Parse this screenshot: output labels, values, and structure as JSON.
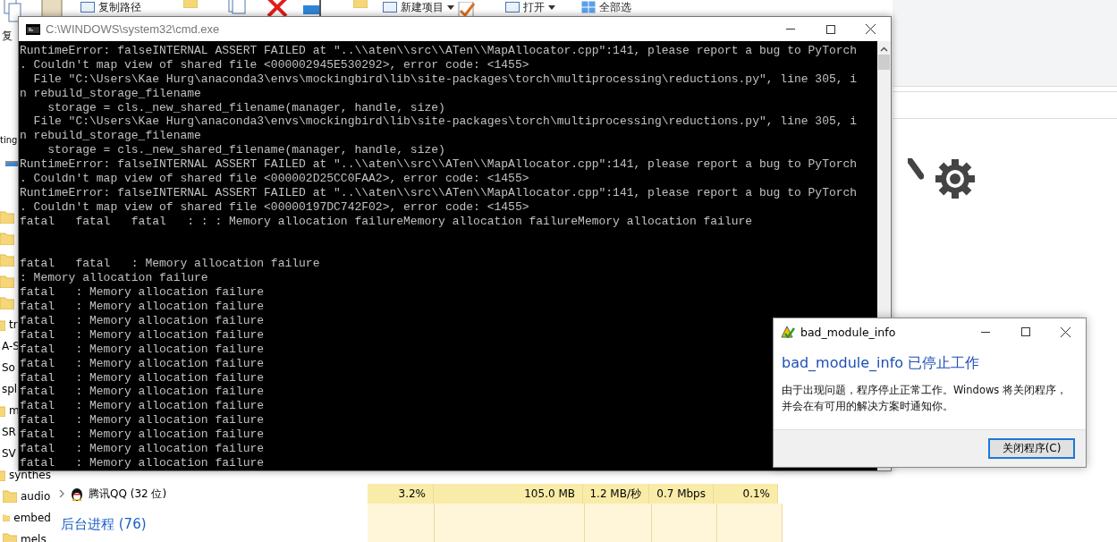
{
  "explorer": {
    "ribbon": [
      {
        "label": "复"
      },
      {
        "label": "复制路径"
      },
      {
        "label": "新建项目",
        "dropdown": true
      },
      {
        "label": "打开",
        "dropdown": true
      },
      {
        "label": "全部选"
      }
    ],
    "sidebar": {
      "header": "ting",
      "items": [
        {
          "kind": "folder"
        },
        {
          "kind": "folder"
        },
        {
          "kind": "folder"
        },
        {
          "kind": "folder"
        },
        {
          "kind": "folder"
        },
        {
          "kind": "folder",
          "text": "tr"
        },
        {
          "kind": "file",
          "text": "A-S"
        },
        {
          "kind": "file",
          "text": "So"
        },
        {
          "kind": "file",
          "text": "spl"
        },
        {
          "kind": "folder",
          "text": "m"
        },
        {
          "kind": "file",
          "text": "SR"
        },
        {
          "kind": "file",
          "text": "SV"
        },
        {
          "kind": "folder",
          "text": "synthes",
          "children": [
            {
              "kind": "folder",
              "text": "audio"
            },
            {
              "kind": "folder",
              "text": "embed"
            },
            {
              "kind": "folder",
              "text": "mels"
            }
          ]
        }
      ]
    }
  },
  "task_manager": {
    "rows": [
      {
        "name": "腾讯QQ (32 位)",
        "expanded": false,
        "cells": [
          "3.2%",
          "105.0 MB",
          "1.2 MB/秒",
          "0.7 Mbps",
          "0.1%"
        ]
      }
    ],
    "group": "后台进程 (76)"
  },
  "console": {
    "title": "C:\\WINDOWS\\system32\\cmd.exe",
    "lines": [
      {
        "text": "RuntimeError: falseINTERNAL ASSERT FAILED at \"..\\\\aten\\\\src\\\\ATen\\\\MapAllocator.cpp\":141, please report a bug to PyTorch"
      },
      {
        "text": ". Couldn't map view of shared file <000002945E530292>, error code: <1455>"
      },
      {
        "text": "  File \"C:\\Users\\Kae Hurg\\anaconda3\\envs\\mockingbird\\lib\\site-packages\\torch\\multiprocessing\\reductions.py\", line 305, i"
      },
      {
        "text": "n rebuild_storage_filename"
      },
      {
        "text": "    storage = cls._new_shared_filename(manager, handle, size)"
      },
      {
        "text": "  File \"C:\\Users\\Kae Hurg\\anaconda3\\envs\\mockingbird\\lib\\site-packages\\torch\\multiprocessing\\reductions.py\", line 305, i"
      },
      {
        "text": "n rebuild_storage_filename"
      },
      {
        "text": "    storage = cls._new_shared_filename(manager, handle, size)"
      },
      {
        "text": "RuntimeError: falseINTERNAL ASSERT FAILED at \"..\\\\aten\\\\src\\\\ATen\\\\MapAllocator.cpp\":141, please report a bug to PyTorch"
      },
      {
        "text": ". Couldn't map view of shared file <000002D25CC0FAA2>, error code: <1455>"
      },
      {
        "text": "RuntimeError: falseINTERNAL ASSERT FAILED at \"..\\\\aten\\\\src\\\\ATen\\\\MapAllocator.cpp\":141, please report a bug to PyTorch"
      },
      {
        "text": ". Couldn't map view of shared file <00000197DC742F02>, error code: <1455>"
      },
      {
        "text": "fatal   fatal   fatal   : : : Memory allocation failureMemory allocation failureMemory allocation failure"
      },
      {
        "text": "fatal   fatal   : Memory allocation failure",
        "blank_lines_before": true
      },
      {
        "text": ": Memory allocation failure"
      },
      {
        "text": "fatal   : Memory allocation failure"
      },
      {
        "text": "fatal   : Memory allocation failure"
      },
      {
        "text": "fatal   : Memory allocation failure"
      },
      {
        "text": "fatal   : Memory allocation failure"
      },
      {
        "text": "fatal   : Memory allocation failure"
      },
      {
        "text": "fatal   : Memory allocation failure"
      },
      {
        "text": "fatal   : Memory allocation failure"
      },
      {
        "text": "fatal   : Memory allocation failure"
      },
      {
        "text": "fatal   : Memory allocation failure"
      },
      {
        "text": "fatal   : Memory allocation failure"
      },
      {
        "text": "fatal   : Memory allocation failure"
      },
      {
        "text": "fatal   : Memory allocation failure"
      },
      {
        "text": "fatal   : Memory allocation failure"
      }
    ]
  },
  "dialog": {
    "title": "bad_module_info",
    "heading": "bad_module_info 已停止工作",
    "message": "由于出现问题，程序停止正常工作。Windows 将关闭程序，并会在有可用的解决方案时通知你。",
    "button": "关闭程序(C)"
  }
}
